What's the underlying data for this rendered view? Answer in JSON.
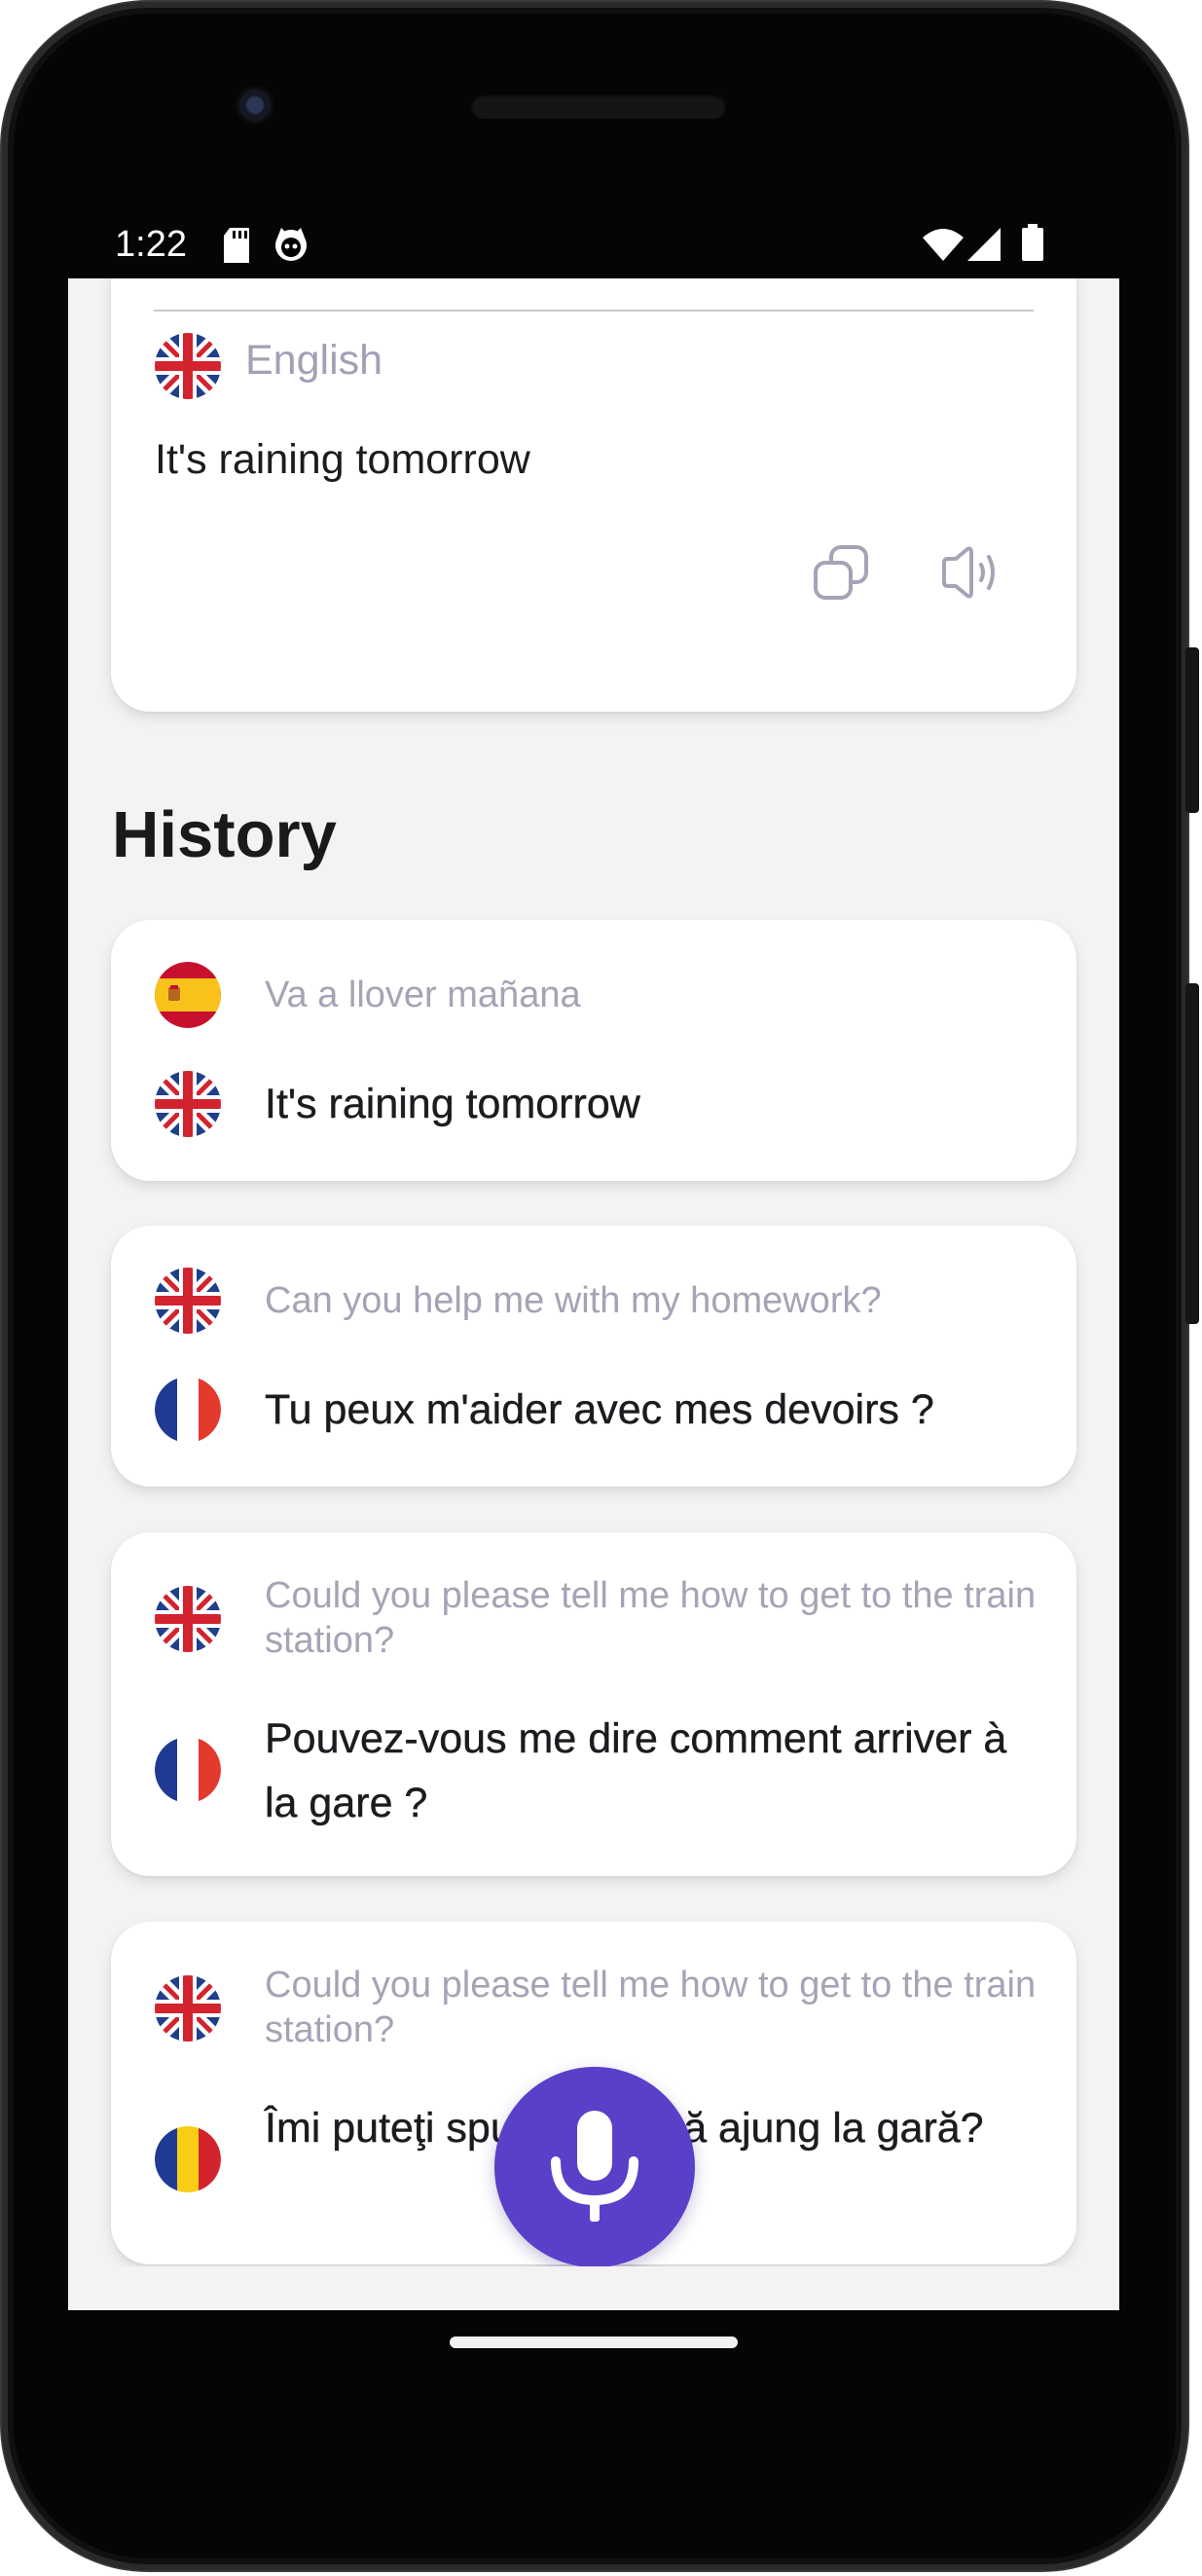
{
  "status_bar": {
    "time": "1:22",
    "left_icons": [
      "sd-card-icon",
      "cat-icon"
    ],
    "right_icons": [
      "wifi-icon",
      "cellular-signal-icon",
      "battery-icon"
    ]
  },
  "result_card": {
    "language": "English",
    "flag": "uk-flag-icon",
    "text": "It's raining tomorrow",
    "actions": [
      {
        "name": "copy-icon"
      },
      {
        "name": "speaker-icon"
      }
    ]
  },
  "history": {
    "title": "History",
    "items": [
      {
        "source_flag": "spain-flag-icon",
        "source_text": "Va a llover mañana",
        "target_flag": "uk-flag-icon",
        "target_text": "It's raining tomorrow"
      },
      {
        "source_flag": "uk-flag-icon",
        "source_text": "Can you help me with my homework?",
        "target_flag": "france-flag-icon",
        "target_text": "Tu peux m'aider avec mes devoirs ?"
      },
      {
        "source_flag": "uk-flag-icon",
        "source_text": "Could you please tell me how to get to the train station?",
        "target_flag": "france-flag-icon",
        "target_text": "Pouvez-vous me dire comment arriver à la gare ?"
      },
      {
        "source_flag": "uk-flag-icon",
        "source_text": "Could you please tell me how to get to the train station?",
        "target_flag": "romania-flag-icon",
        "target_text": "Îmi puteţi spune cum să ajung la gară?"
      }
    ]
  },
  "mic_button": {
    "icon": "microphone-icon"
  },
  "colors": {
    "accent": "#5a3fc8",
    "background": "#f4f2f3",
    "card": "#ffffff",
    "muted_text": "#a5a3b5",
    "primary_text": "#1c1b1f"
  }
}
